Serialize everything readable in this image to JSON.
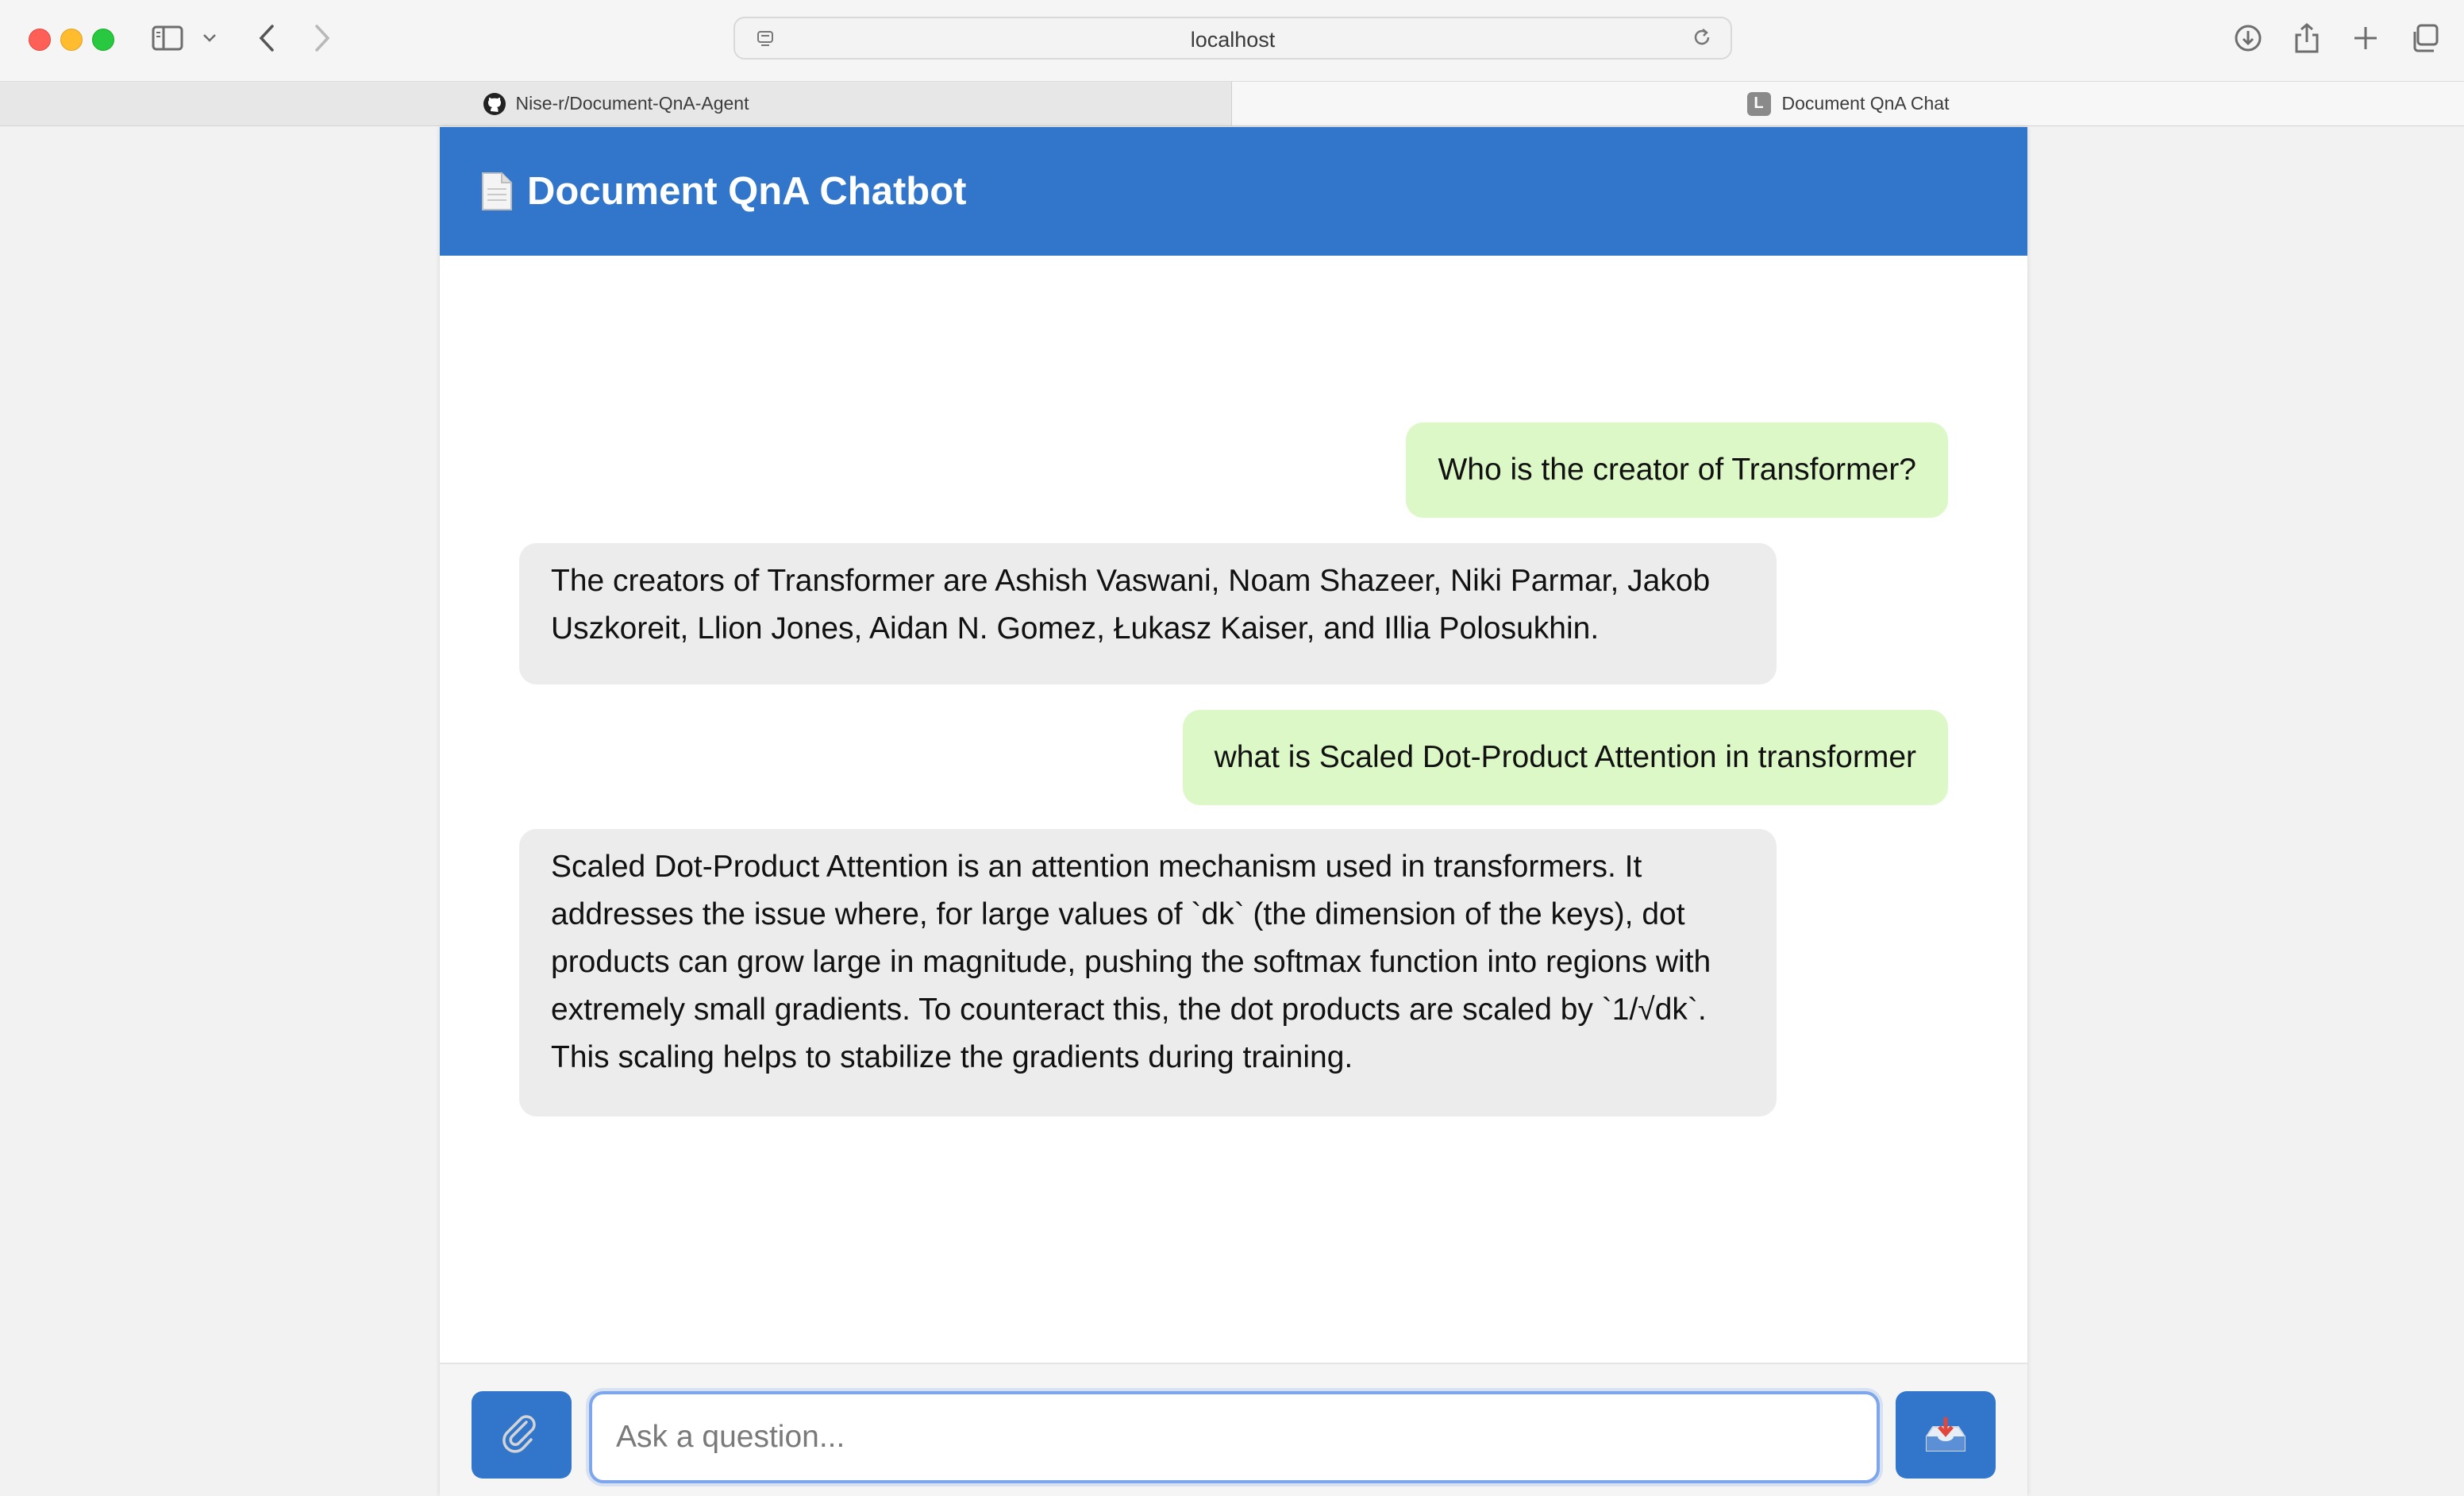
{
  "browser": {
    "url": "localhost",
    "tabs": [
      {
        "label": "Nise-r/Document-QnA-Agent",
        "icon": "github-icon"
      },
      {
        "label": "Document QnA Chat",
        "icon": "l-favicon-icon",
        "favicon_letter": "L"
      }
    ]
  },
  "app": {
    "title": "Document QnA Chatbot",
    "title_icon": "document-icon",
    "header_color": "#3276cb"
  },
  "messages": [
    {
      "role": "user",
      "text": "Who is the creator of Transformer?"
    },
    {
      "role": "bot",
      "text": "The creators of Transformer are Ashish Vaswani, Noam Shazeer, Niki Parmar, Jakob Uszkoreit, Llion Jones, Aidan N. Gomez, Łukasz Kaiser, and Illia Polosukhin."
    },
    {
      "role": "user",
      "text": "what is Scaled Dot-Product Attention in transformer"
    },
    {
      "role": "bot",
      "text": "Scaled Dot-Product Attention is an attention mechanism used in transformers. It addresses the issue where, for large values of `dk` (the dimension of the keys), dot products can grow large in magnitude, pushing the softmax function into regions with extremely small gradients. To counteract this, the dot products are scaled by `1/√dk`. This scaling helps to stabilize the gradients during training."
    }
  ],
  "input": {
    "placeholder": "Ask a question...",
    "value": "",
    "attach_icon": "paperclip-icon",
    "send_icon": "inbox-tray-icon"
  },
  "colors": {
    "user_bubble": "#dcf8c6",
    "bot_bubble": "#ececec",
    "accent": "#3276cb"
  }
}
